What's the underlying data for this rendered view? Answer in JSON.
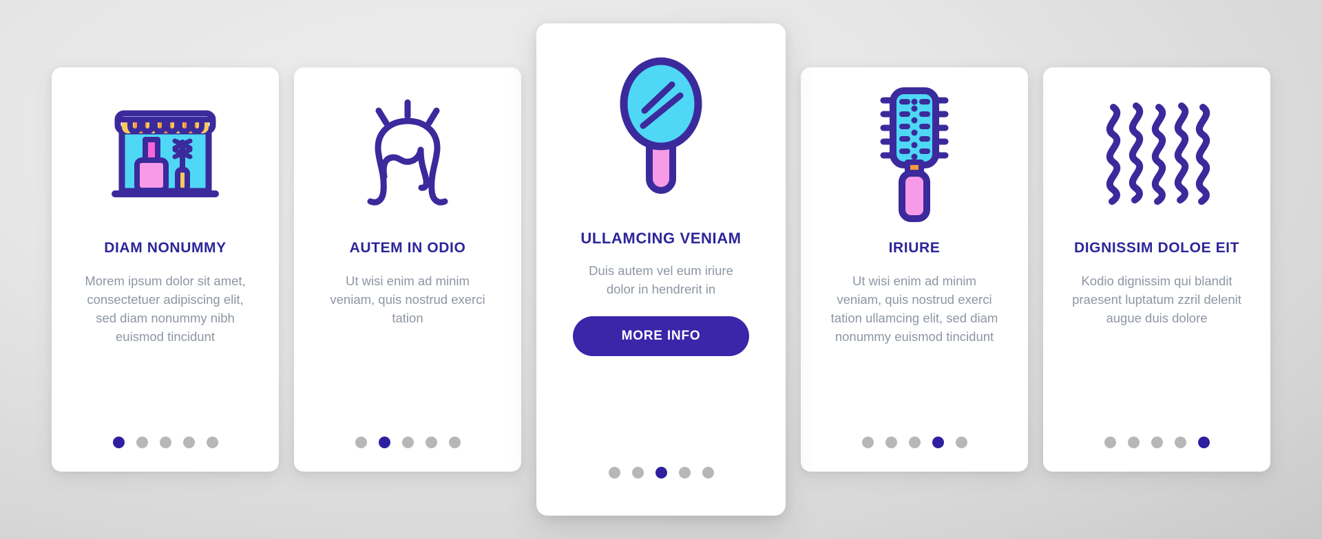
{
  "theme": {
    "title_color": "#2e2599",
    "body_color": "#8d96a3",
    "accent_color": "#3b25a8",
    "dot_active_color": "#2e1f9e",
    "dot_inactive_color": "#b7b7b7",
    "card_bg": "#ffffff",
    "page_bg": "#e3e3e3",
    "icon_outline": "#3b2a9c",
    "icon_cyan": "#4fd8f5",
    "icon_pink": "#f79ae8",
    "icon_magenta": "#f766d8",
    "icon_orange": "#f7993f",
    "icon_yellow": "#fbc860"
  },
  "cards": [
    {
      "id": "card-1",
      "icon_name": "nail-salon-storefront-icon",
      "title": "DIAM NONUMMY",
      "body": "Morem ipsum dolor sit amet, consectetuer adipiscing elit, sed diam nonummy nibh euismod tincidunt",
      "dots": {
        "count": 5,
        "active_index": 0
      },
      "has_button": false,
      "featured": false
    },
    {
      "id": "card-2",
      "icon_name": "wig-hairstyle-icon",
      "title": "AUTEM IN ODIO",
      "body": "Ut wisi enim ad minim veniam, quis nostrud exerci tation",
      "dots": {
        "count": 5,
        "active_index": 1
      },
      "has_button": false,
      "featured": false
    },
    {
      "id": "card-3",
      "icon_name": "hand-mirror-icon",
      "title": "ULLAMCING VENIAM",
      "body": "Duis autem vel eum iriure dolor in hendrerit in",
      "button_label": "MORE INFO",
      "dots": {
        "count": 5,
        "active_index": 2
      },
      "has_button": true,
      "featured": true
    },
    {
      "id": "card-4",
      "icon_name": "hairbrush-icon",
      "title": "IRIURE",
      "body": "Ut wisi enim ad minim veniam, quis nostrud exerci tation ullamcing elit, sed diam nonummy euismod tincidunt",
      "dots": {
        "count": 5,
        "active_index": 3
      },
      "has_button": false,
      "featured": false
    },
    {
      "id": "card-5",
      "icon_name": "wavy-hair-icon",
      "title": "DIGNISSIM DOLOE EIT",
      "body": "Kodio dignissim qui blandit praesent luptatum zzril delenit augue duis dolore",
      "dots": {
        "count": 5,
        "active_index": 4
      },
      "has_button": false,
      "featured": false
    }
  ]
}
